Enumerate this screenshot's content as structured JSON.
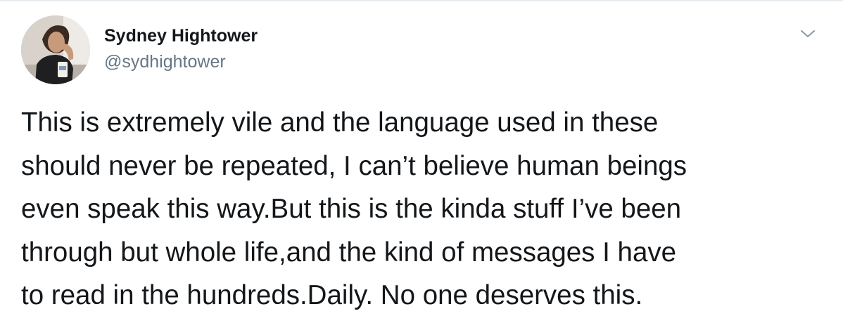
{
  "author": {
    "name": "Sydney Hightower",
    "handle": "@sydhightower"
  },
  "icons": {
    "menu": "chevron-down-icon",
    "avatar": "profile-photo"
  },
  "tweet": {
    "lines": [
      "This is extremely vile and the language used in these",
      "should never be repeated, I can’t believe human beings",
      "even speak this way.But this is the kinda stuff I’ve been",
      "through but whole life,and the kind of messages I have",
      "to read in the hundreds.Daily. No one deserves this."
    ]
  },
  "colors": {
    "text": "#14171a",
    "handle": "#657786",
    "caret": "#8899a6"
  }
}
